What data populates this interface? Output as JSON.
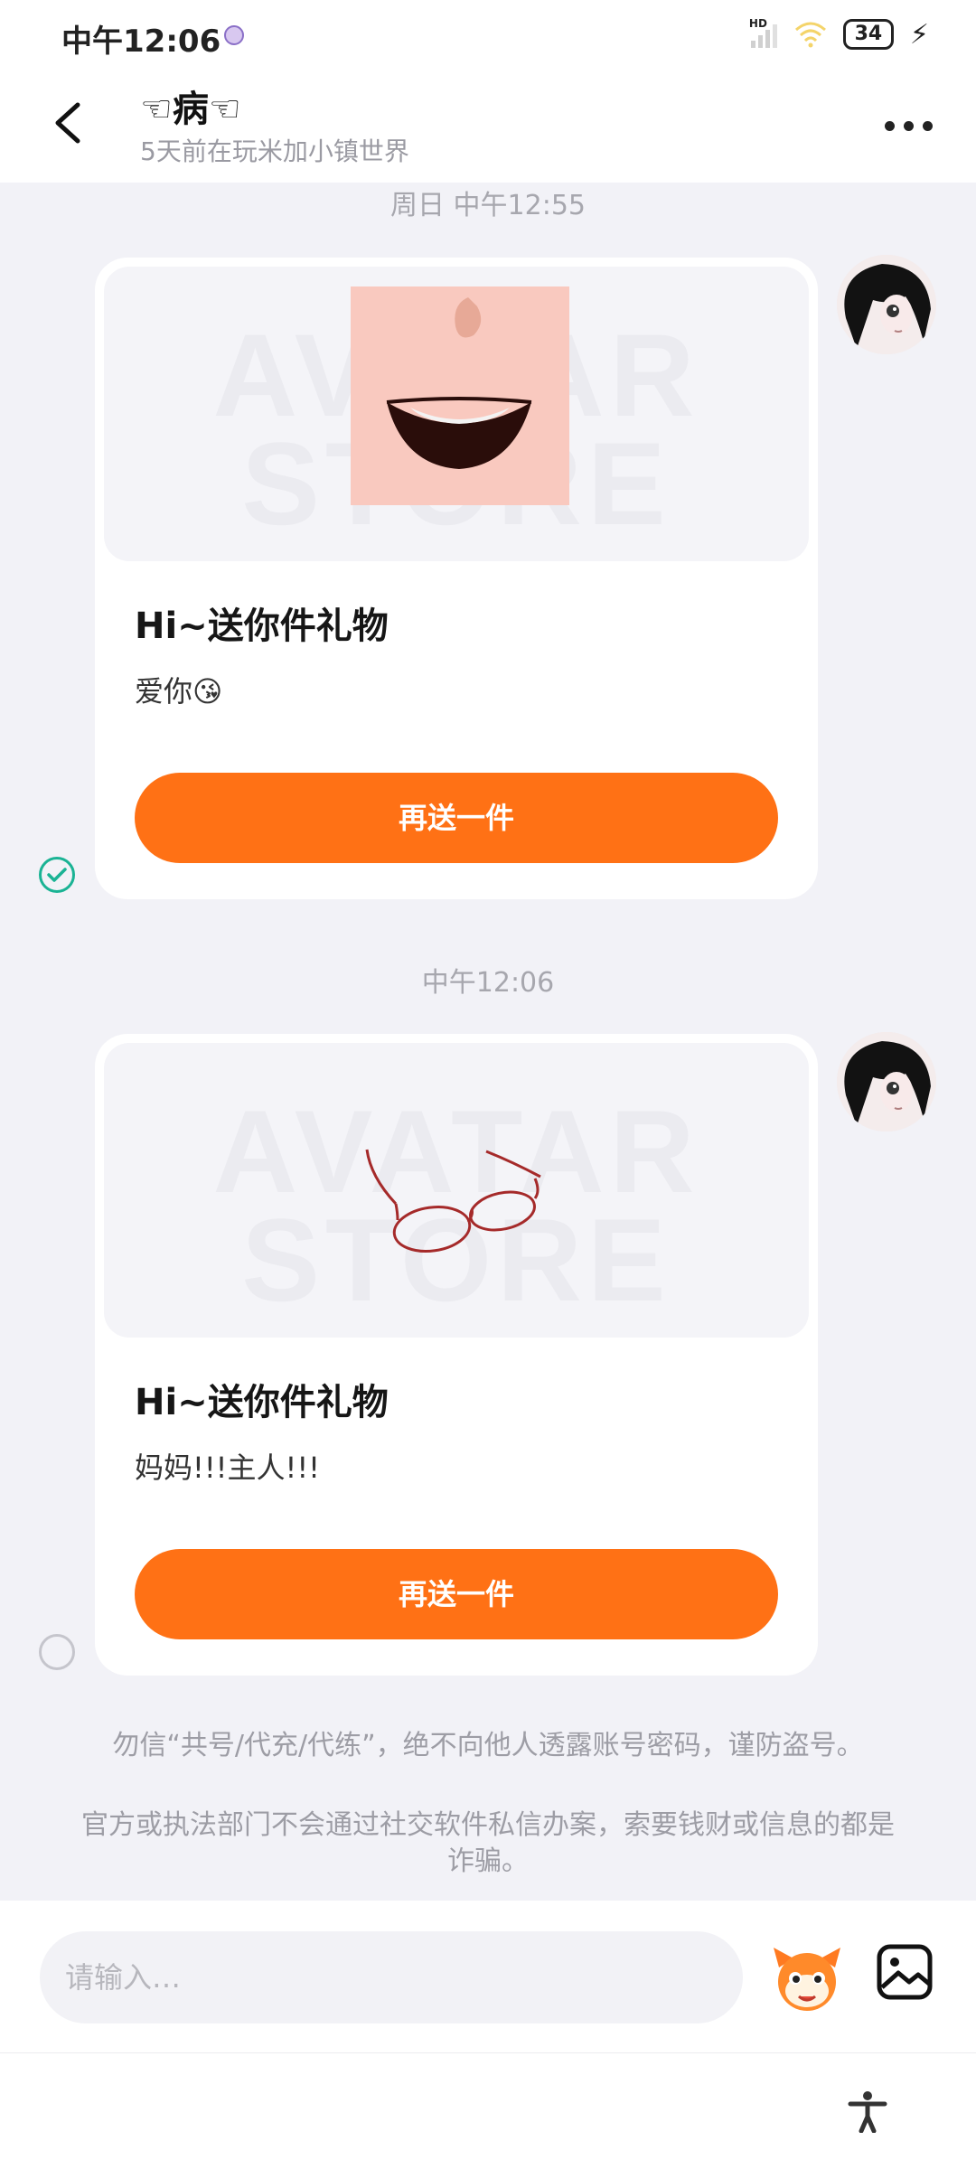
{
  "status_bar": {
    "time": "中午12:06",
    "network": "HD",
    "battery": "34"
  },
  "header": {
    "contact_name": "☜病☜",
    "contact_status": "5天前在玩米加小镇世界"
  },
  "messages": [
    {
      "time": "周日 中午12:55",
      "watermark_line1": "AVATAR",
      "watermark_line2": "STORE",
      "title": "Hi~送你件礼物",
      "text": "爱你😘",
      "button": "再送一件",
      "gift": "mouth",
      "selected": true
    },
    {
      "time": "中午12:06",
      "watermark_line1": "AVATAR",
      "watermark_line2": "STORE",
      "title": "Hi~送你件礼物",
      "text": "妈妈!!!主人!!!",
      "button": "再送一件",
      "gift": "glasses",
      "selected": false
    }
  ],
  "notices": {
    "line1": "勿信“共号/代充/代练”，绝不向他人透露账号密码，谨防盗号。",
    "line2": "官方或执法部门不会通过社交软件私信办案，索要钱财或信息的都是诈骗。"
  },
  "input": {
    "placeholder": "请输入…"
  },
  "colors": {
    "accent": "#ff7115",
    "check": "#1ab394",
    "background": "#f2f2f7"
  }
}
